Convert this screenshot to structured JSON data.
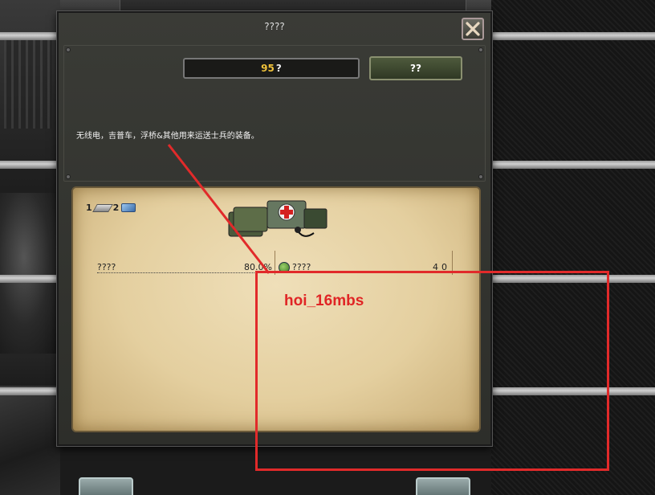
{
  "dialog": {
    "title": "????",
    "close_label": "close",
    "cost": {
      "value": "95",
      "unit": "?"
    },
    "confirm_label": "??",
    "description": "无线电，吉普车，浮桥&其他用来运送士兵的装备。"
  },
  "requirements": [
    {
      "count": "1",
      "icon": "steel-plate-icon"
    },
    {
      "count": "2",
      "icon": "blue-ingot-icon"
    }
  ],
  "equipment_icon": "support-equipment-crates-icon",
  "stats": {
    "left": {
      "label": "????",
      "value": "80.0%"
    },
    "right": {
      "label": "????",
      "value": "40",
      "icon": "green-leaf-icon"
    }
  },
  "annotation": {
    "text": "hoi_16mbs",
    "color": "#e12a2a"
  },
  "colors": {
    "cost_value": "#f0c23a",
    "parchment": "#e4cf9f"
  }
}
